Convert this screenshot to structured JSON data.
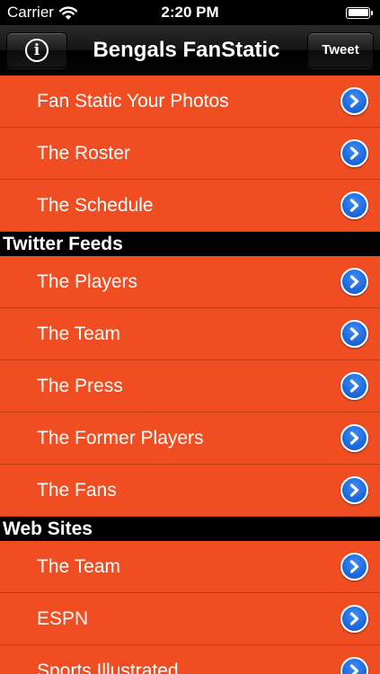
{
  "status_bar": {
    "carrier": "Carrier",
    "time": "2:20 PM",
    "wifi_icon": "wifi-icon",
    "battery_icon": "battery-icon"
  },
  "nav": {
    "title": "Bengals FanStatic",
    "info_icon": "info-icon",
    "info_glyph": "i",
    "tweet_label": "Tweet"
  },
  "colors": {
    "row_background": "#f04e22",
    "section_header": "#000000",
    "disclosure_blue": "#1f6ce0"
  },
  "sections": [
    {
      "header": "",
      "items": [
        {
          "label": "Fan Static Your Photos"
        },
        {
          "label": "The Roster"
        },
        {
          "label": "The Schedule"
        }
      ]
    },
    {
      "header": "Twitter Feeds",
      "items": [
        {
          "label": "The Players"
        },
        {
          "label": "The Team"
        },
        {
          "label": "The Press"
        },
        {
          "label": "The Former Players"
        },
        {
          "label": "The Fans"
        }
      ]
    },
    {
      "header": "Web Sites",
      "items": [
        {
          "label": "The Team"
        },
        {
          "label": "ESPN"
        },
        {
          "label": "Sports Illustrated"
        }
      ]
    }
  ]
}
